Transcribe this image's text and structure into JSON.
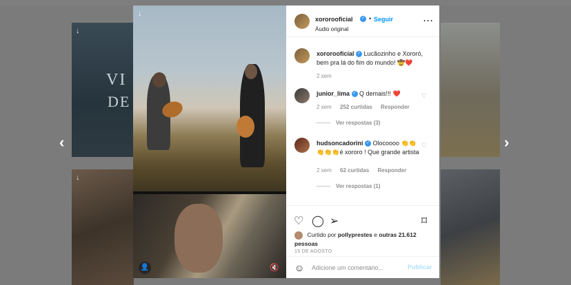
{
  "post": {
    "username": "xororooficial",
    "follow_label": "Seguir",
    "audio_label": "Áudio original",
    "caption": "Lucãozinho e Xororó, bem pra lá do fim do mundo! 🤠❤️",
    "caption_time": "2 sem",
    "liked_by_prefix": "Curtido por",
    "liked_by_user": "pollyprestes",
    "liked_by_and": "e",
    "liked_by_others": "outras 21.612 pessoas",
    "date": "15 DE AGOSTO",
    "comment_placeholder": "Adicione um comentário...",
    "post_button": "Publicar"
  },
  "comments": [
    {
      "username": "junior_lima",
      "text": "Q demais!!! ❤️",
      "time": "2 sem",
      "likes": "252 curtidas",
      "reply_label": "Responder",
      "view_replies": "Ver respostas (3)"
    },
    {
      "username": "hudsoncadorini",
      "text": "Olocoooo 👏👏👏👏👏é xororo ! Que grande artista",
      "time": "2 sem",
      "likes": "62 curtidas",
      "reply_label": "Responder",
      "view_replies": "Ver respostas (1)"
    }
  ],
  "background": {
    "tile_text_1": "VI",
    "tile_text_2": "DE"
  },
  "icons": {
    "verified": "verified-badge-icon",
    "more": "more-options-icon",
    "heart": "heart-icon",
    "comment": "comment-icon",
    "share": "share-icon",
    "save": "save-icon",
    "emoji": "emoji-icon",
    "download": "download-arrow-icon",
    "user_tag": "user-tag-icon",
    "mute": "mute-icon",
    "prev": "chevron-left-icon",
    "next": "chevron-right-icon"
  },
  "colors": {
    "accent": "#0095f6",
    "verified": "#3897f0",
    "like_heart": "#ed4956",
    "overlay": "#7b7b7b"
  }
}
